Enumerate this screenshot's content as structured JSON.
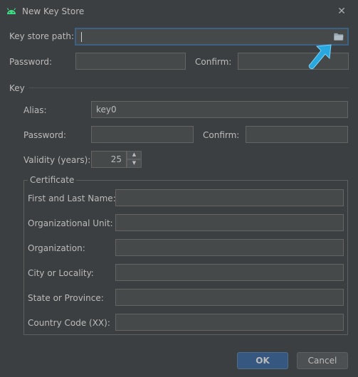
{
  "window": {
    "title": "New Key Store",
    "close_glyph": "✕"
  },
  "keystore": {
    "path_label": "Key store path:",
    "path_value": "",
    "password_label": "Password:",
    "confirm_label": "Confirm:"
  },
  "key": {
    "section_label": "Key",
    "alias_label": "Alias:",
    "alias_value": "key0",
    "password_label": "Password:",
    "confirm_label": "Confirm:",
    "validity_label": "Validity (years):",
    "validity_value": "25",
    "spinner_up": "▲",
    "spinner_down": "▼"
  },
  "certificate": {
    "legend": "Certificate",
    "fields": [
      {
        "label": "First and Last Name:",
        "value": ""
      },
      {
        "label": "Organizational Unit:",
        "value": ""
      },
      {
        "label": "Organization:",
        "value": ""
      },
      {
        "label": "City or Locality:",
        "value": ""
      },
      {
        "label": "State or Province:",
        "value": ""
      },
      {
        "label": "Country Code (XX):",
        "value": ""
      }
    ]
  },
  "buttons": {
    "ok": "OK",
    "cancel": "Cancel"
  },
  "colors": {
    "accent": "#365880",
    "focus": "#3d6185",
    "android": "#3ddc84",
    "pointer": "#29a8e0"
  },
  "icons": [
    "android-icon",
    "close-icon",
    "folder-icon",
    "pointer-arrow-icon"
  ]
}
